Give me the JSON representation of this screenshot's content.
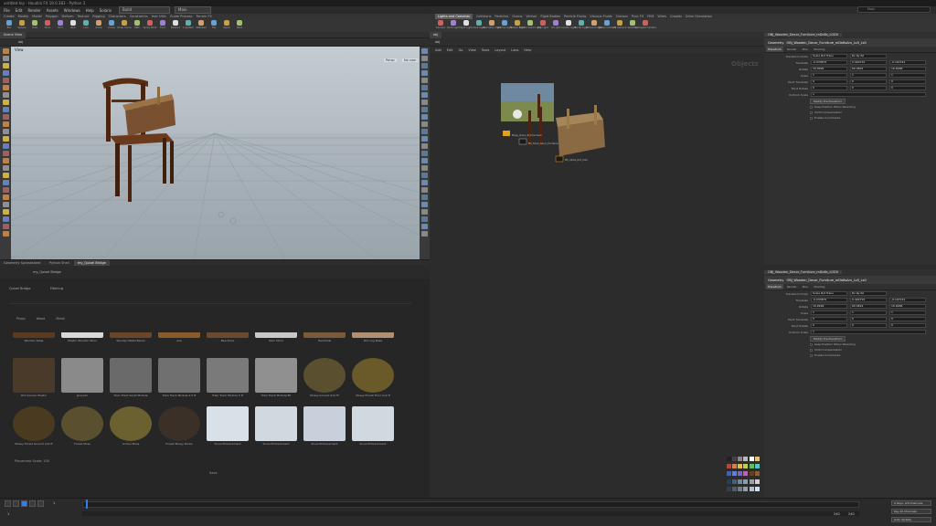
{
  "window": {
    "title": "untitled.hip - Houdini FX 19.0.383 - Python 3"
  },
  "menubar": {
    "items": [
      "File",
      "Edit",
      "Render",
      "Assets",
      "Windows",
      "Help",
      "Solaris"
    ],
    "desktop": "Build",
    "desktop2": "Main"
  },
  "shelf_left": {
    "tabs": [
      "Create",
      "Modify",
      "Model",
      "Polygon",
      "Deform",
      "Texture",
      "Rigging",
      "Characters",
      "Constraints",
      "Hair Utils",
      "Guide Process",
      "Terrain FX"
    ],
    "tools": [
      "Box",
      "Sphere",
      "Tube",
      "Torus",
      "Grid",
      "Null",
      "Line",
      "Circle",
      "Curve",
      "Draw Curve",
      "Path",
      "Spray Paint",
      "Font",
      "Platonic",
      "L-System",
      "Metaball",
      "File",
      "Spiral",
      "Helix"
    ]
  },
  "shelf_right": {
    "tabs": [
      "Lights and Cameras",
      "Collisions",
      "Particles",
      "Grains",
      "Vellum",
      "Rigid Bodies",
      "Particle Fluids",
      "Viscous Fluids",
      "Oceans",
      "Pyro FX",
      "FEM",
      "Wires",
      "Crowds",
      "Drive Simulation"
    ],
    "active_tab": "Lights and Cameras",
    "tools": [
      "Camera",
      "Point Light",
      "Spot Light",
      "Area Light",
      "Geometry Light",
      "Volume Light",
      "Distant Light",
      "Environment Light",
      "Sky Light",
      "GI Light",
      "Caustic Light",
      "Portal Light",
      "Ambient Light",
      "Stereo Camera",
      "VR Camera",
      "Switcher",
      "Gamepad Camera"
    ]
  },
  "search": {
    "placeholder": "Main"
  },
  "viewport": {
    "tab": "Scene View",
    "path": "obj",
    "label": "View",
    "persp": "Persp",
    "cam": "No cam"
  },
  "mid_tabs": [
    "Geometry Spreadsheet",
    "Python Shell",
    "my_Quixel Bridge"
  ],
  "mid_path": "my_Quixel Bridge",
  "browser": {
    "tabs": [
      "Quixel Bridge",
      "Filtering"
    ],
    "filters": [
      "Props",
      "Wood",
      "Metal"
    ],
    "rows": [
      [
        "Wooden Table",
        "Plastic Wooden Stool",
        "Wooden Metal Barrel",
        "Axe",
        "Bee Stool",
        "Ram Stool",
        "Handrails",
        "Rim Log Base"
      ],
      [
        "Old Cannon Plastic",
        "Jerrycan",
        "Train Track Small Module",
        "Train Track Module 2.5 ft",
        "Train Track Module 5 ft",
        "Train Track Module 80",
        "Mossy Ground 2x2 Ft",
        "Mossy Forest Floor 2x2 ft"
      ],
      [
        "Mossy Forest Ground 2x2 ft",
        "Forest Moss",
        "Lichen Moss",
        "Forest Mossy Rocks",
        "Snow Embankment",
        "Snow Embankment",
        "Snow Embankment",
        "Snow Embankment"
      ]
    ],
    "footer": "Placement Scale:  100",
    "save": "Save"
  },
  "network": {
    "tab": "obj",
    "path": "obj",
    "menu": [
      "Add",
      "Edit",
      "Go",
      "View",
      "Tools",
      "Layout",
      "Labs",
      "Help"
    ],
    "context": "Objects",
    "nodes": [
      "Mega_Scans_Environment",
      "MS_Fixed_Decor_Furniture",
      "MS_Alpha_Dirt_Cam"
    ]
  },
  "params_top": {
    "tab": "OBJ_Wooden_Decor_Furniture_mDe8s_LOD0",
    "type": "Geometry",
    "name": "OBJ_Wooden_Decor_Furniture_mDe8sAm_Lv0_Ls0",
    "tabs": [
      "Transform",
      "Render",
      "Misc",
      "Shading"
    ],
    "rows": [
      {
        "label": "Transform Order",
        "values": [
          "Scale Rot Trans",
          "Rx Ry Rz"
        ]
      },
      {
        "label": "Translate",
        "values": [
          "-0.033874",
          "0.440715",
          "-0.197221"
        ]
      },
      {
        "label": "Rotate",
        "values": [
          "16.9999",
          "60.4822",
          "16.6966"
        ]
      },
      {
        "label": "Scale",
        "values": [
          "1",
          "1",
          "1"
        ]
      },
      {
        "label": "Pivot Translate",
        "values": [
          "0",
          "0",
          "0"
        ]
      },
      {
        "label": "Pivot Rotate",
        "values": [
          "0",
          "0",
          "0"
        ]
      },
      {
        "label": "Uniform Scale",
        "values": [
          "1"
        ]
      }
    ],
    "button": "Modify Pre-Transform",
    "checks": [
      "Keep Position When Parenting",
      "Child Compensation",
      "Enable Constraints"
    ]
  },
  "params_bot": {
    "tab": "OBJ_Wooden_Decor_Furniture_mDe8s_LOD0",
    "type": "Geometry",
    "name": "OBJ_Wooden_Decor_Furniture_mDe8sAm_Lv0_Ls0",
    "tabs": [
      "Transform",
      "Render",
      "Misc",
      "Shading"
    ],
    "rows": [
      {
        "label": "Transform Order",
        "values": [
          "Scale Rot Trans",
          "Rx Ry Rz"
        ]
      },
      {
        "label": "Translate",
        "values": [
          "-0.033874",
          "0.440715",
          "-0.197221"
        ]
      },
      {
        "label": "Rotate",
        "values": [
          "16.9999",
          "60.4822",
          "16.6966"
        ]
      },
      {
        "label": "Scale",
        "values": [
          "1",
          "1",
          "1"
        ]
      },
      {
        "label": "Pivot Translate",
        "values": [
          "0",
          "0",
          "0"
        ]
      },
      {
        "label": "Pivot Rotate",
        "values": [
          "0",
          "0",
          "0"
        ]
      },
      {
        "label": "Uniform Scale",
        "values": [
          "1"
        ]
      }
    ],
    "button": "Modify Pre-Transform",
    "checks": [
      "Keep Position When Parenting",
      "Child Compensation",
      "Enable Constraints"
    ]
  },
  "timeline": {
    "start": "1",
    "end": "240",
    "cur": "1",
    "a": "240",
    "b": "240",
    "dd1": "0 Keys, 0/0 Channels",
    "dd2": "Key All Channels",
    "dd3": "Auto Update"
  },
  "colors": {
    "accent": "#2f7df2",
    "bg": "#2b2b2b"
  }
}
